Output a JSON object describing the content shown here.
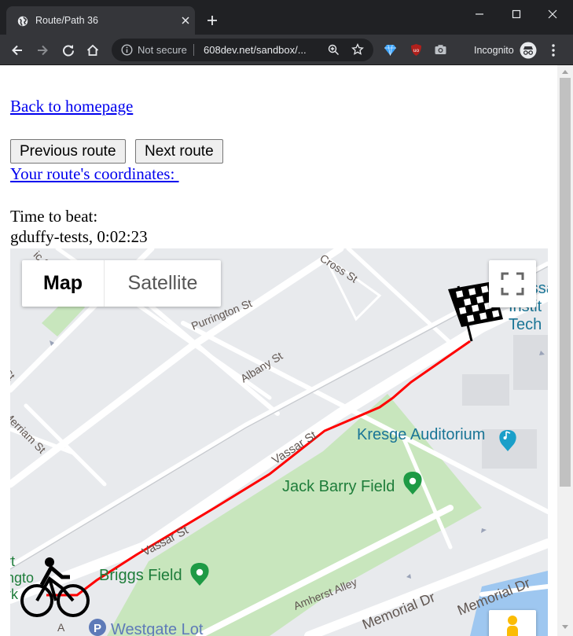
{
  "browser": {
    "tab_title": "Route/Path 36",
    "security_label": "Not secure",
    "url": "608dev.net/sandbox/...",
    "incognito_label": "Incognito"
  },
  "page": {
    "home_link": "Back to homepage",
    "prev_button": "Previous route",
    "next_button": "Next route",
    "coords_link": "Your route's coordinates: ",
    "time_to_beat_label": "Time to beat:",
    "time_to_beat_value": "gduffy-tests, 0:02:23"
  },
  "map": {
    "type_map": "Map",
    "type_satellite": "Satellite",
    "streets": {
      "purrington": "Purrington St",
      "albany": "Albany St",
      "cross": "Cross St",
      "merriam": "Merriam St",
      "vassar_upper": "Vassar St",
      "vassar_lower": "Vassar St",
      "amherst": "Amherst Alley",
      "memorial_left": "Memorial Dr",
      "memorial_right": "Memorial Dr",
      "st_fragment": "St",
      "ic_st": "ic St",
      "art_fragment": "rt",
      "ngto_fragment": "ngto",
      "rk_fragment": "rk",
      "a_fragment": "A"
    },
    "pois": {
      "kresge": "Kresge Auditorium",
      "jack_barry": "Jack Barry Field",
      "briggs": "Briggs Field",
      "westgate": "Westgate Lot",
      "mit_line1": "Massa",
      "mit_line2": "Instit",
      "mit_line3": "Tech"
    },
    "route_color": "#ff0000",
    "park_color": "#c8e6bd",
    "water_color": "#9ec7f0"
  }
}
